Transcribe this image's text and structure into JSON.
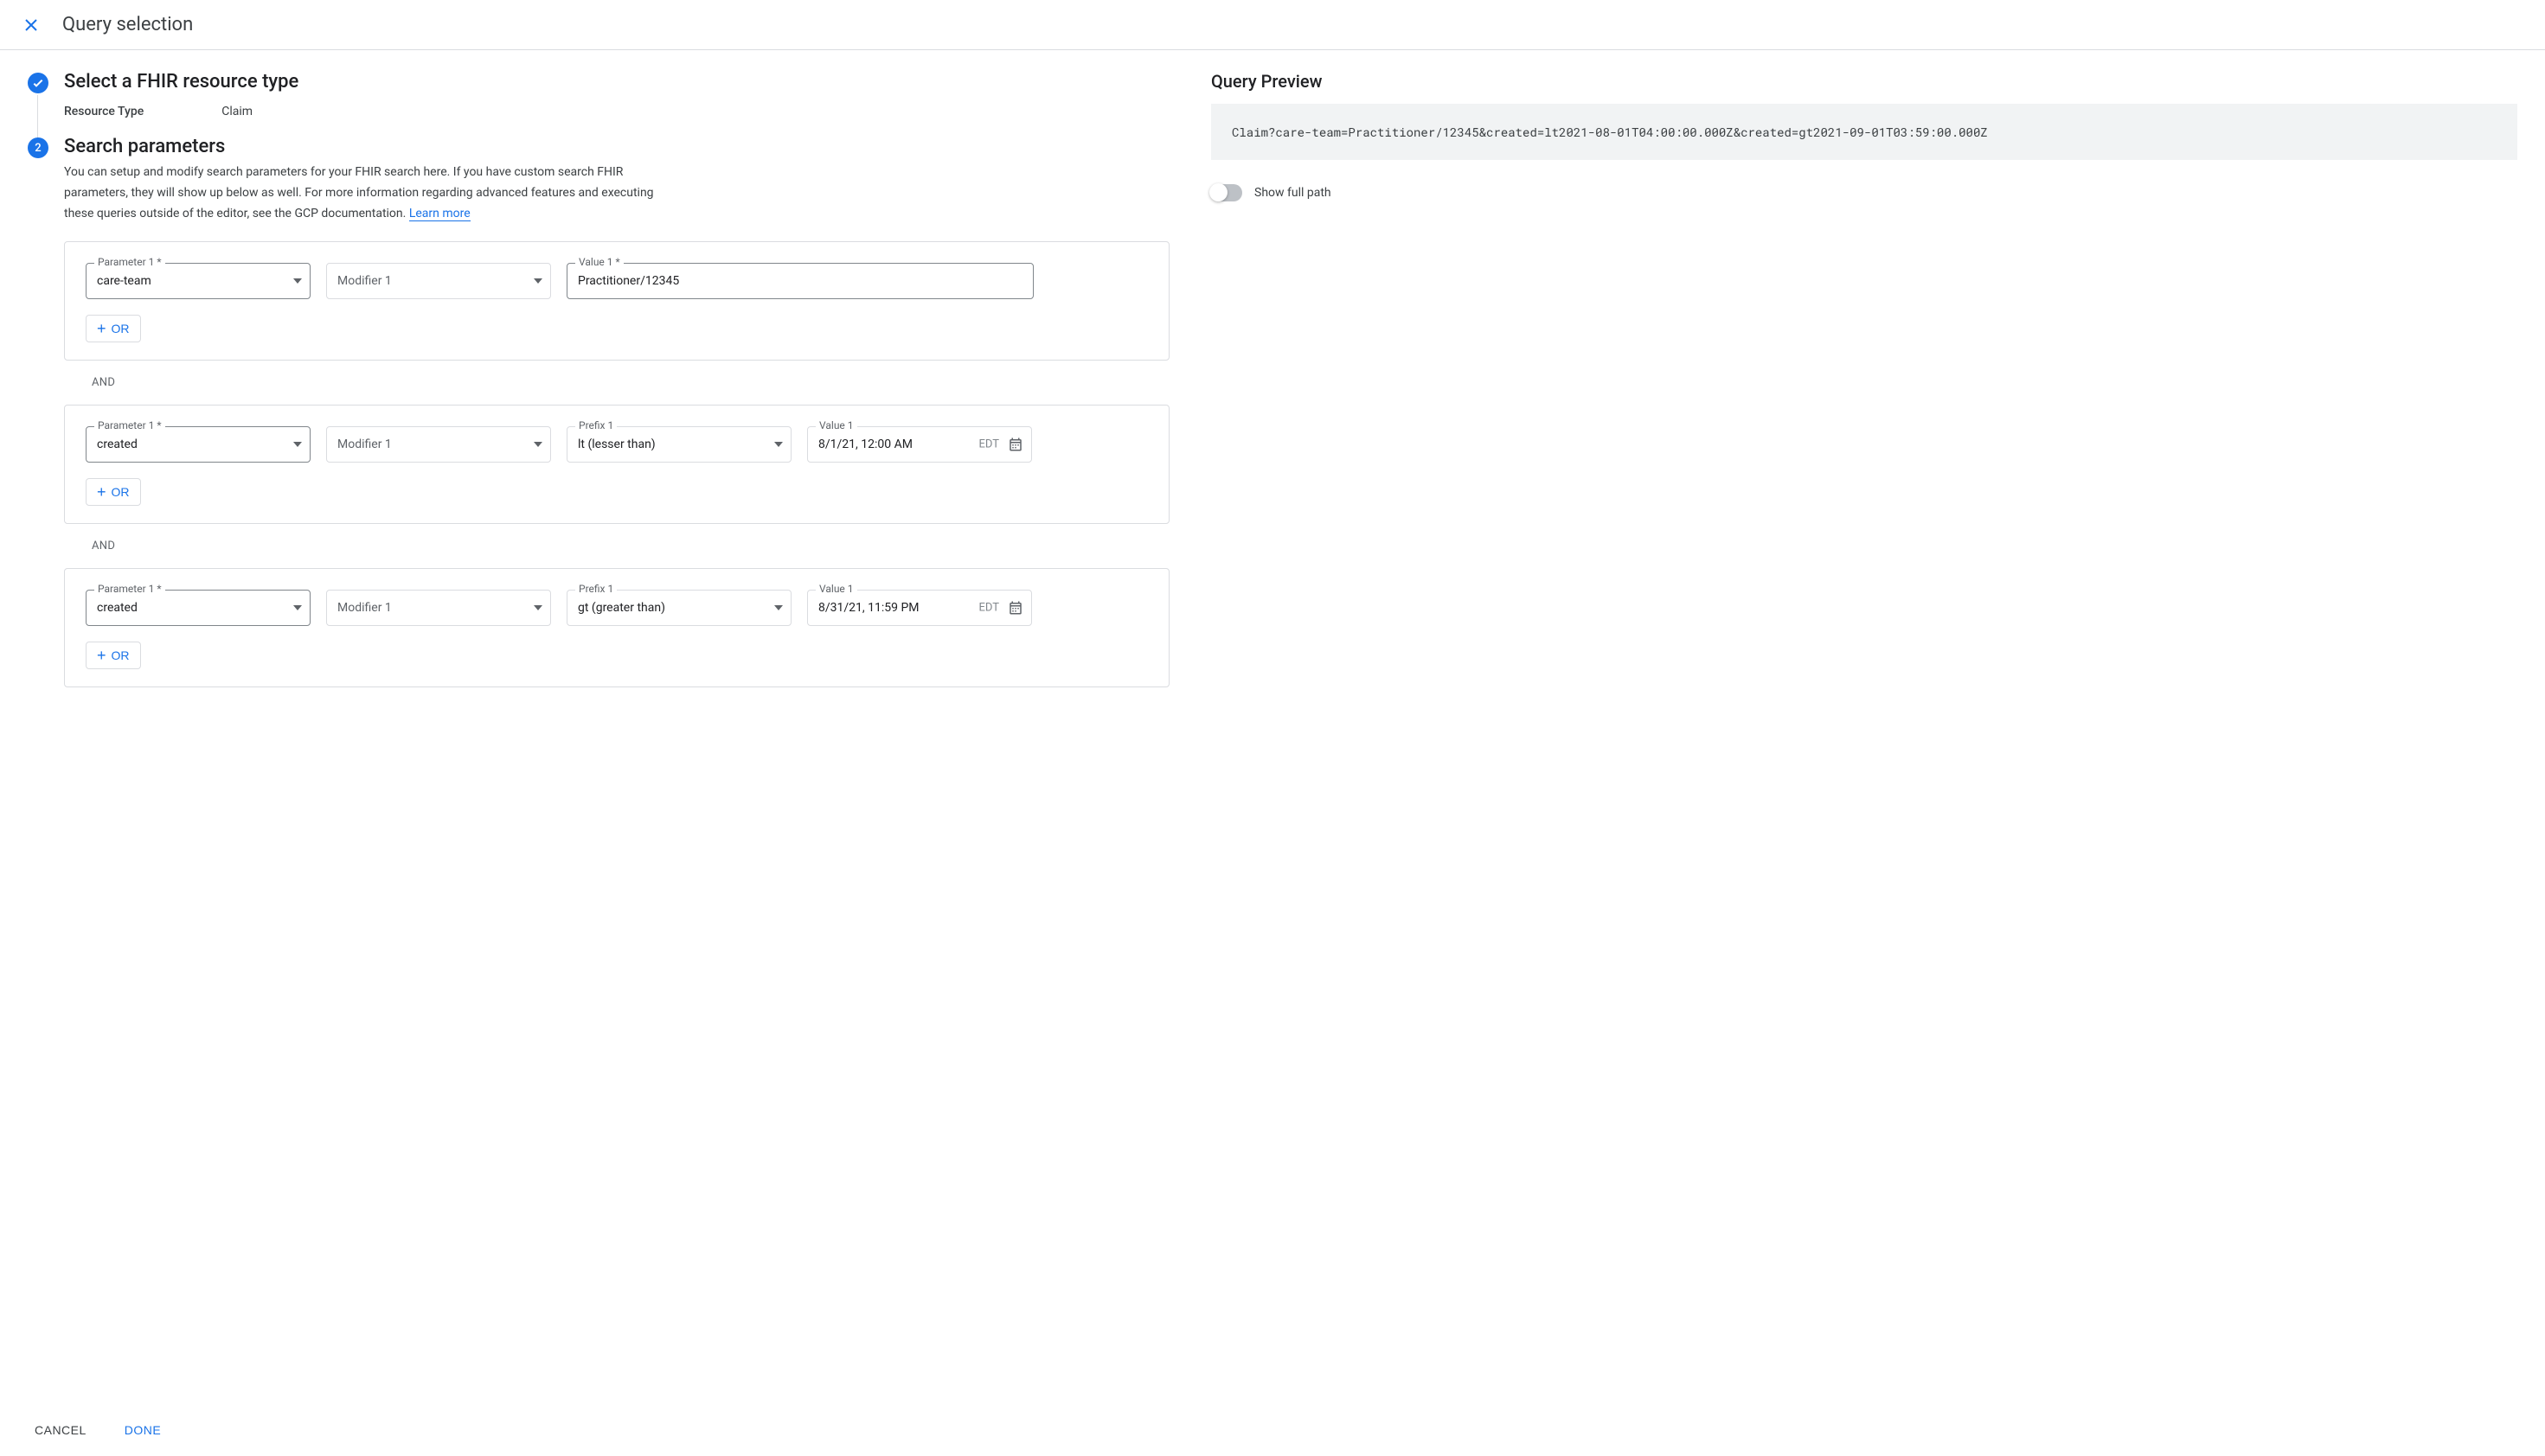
{
  "header": {
    "title": "Query selection"
  },
  "step1": {
    "title": "Select a FHIR resource type",
    "resourceTypeLabel": "Resource Type",
    "resourceTypeValue": "Claim"
  },
  "step2": {
    "number": "2",
    "title": "Search parameters",
    "description": "You can setup and modify search parameters for your FHIR search here. If you have custom search FHIR parameters, they will show up below as well. For more information regarding advanced features and executing these queries outside of the editor, see the GCP documentation. ",
    "learnMore": "Learn more",
    "groups": [
      {
        "parameterLabel": "Parameter 1 *",
        "parameterValue": "care-team",
        "modifierLabel": "Modifier 1",
        "modifierValue": "",
        "prefixLabel": "",
        "prefixValue": "",
        "valueLabel": "Value 1 *",
        "valueValue": "Practitioner/12345",
        "valueType": "text",
        "orLabel": "OR"
      },
      {
        "parameterLabel": "Parameter 1 *",
        "parameterValue": "created",
        "modifierLabel": "Modifier 1",
        "modifierValue": "",
        "prefixLabel": "Prefix 1",
        "prefixValue": "lt (lesser than)",
        "valueLabel": "Value 1",
        "valueValue": "8/1/21, 12:00 AM",
        "valueSuffix": "EDT",
        "valueType": "date",
        "orLabel": "OR"
      },
      {
        "parameterLabel": "Parameter 1 *",
        "parameterValue": "created",
        "modifierLabel": "Modifier 1",
        "modifierValue": "",
        "prefixLabel": "Prefix 1",
        "prefixValue": "gt (greater than)",
        "valueLabel": "Value 1",
        "valueValue": "8/31/21, 11:59 PM",
        "valueSuffix": "EDT",
        "valueType": "date",
        "orLabel": "OR"
      }
    ],
    "andLabel": "AND"
  },
  "preview": {
    "title": "Query Preview",
    "query": "Claim?care-team=Practitioner/12345&created=lt2021-08-01T04:00:00.000Z&created=gt2021-09-01T03:59:00.000Z",
    "toggleLabel": "Show full path"
  },
  "footer": {
    "cancel": "CANCEL",
    "done": "DONE"
  }
}
